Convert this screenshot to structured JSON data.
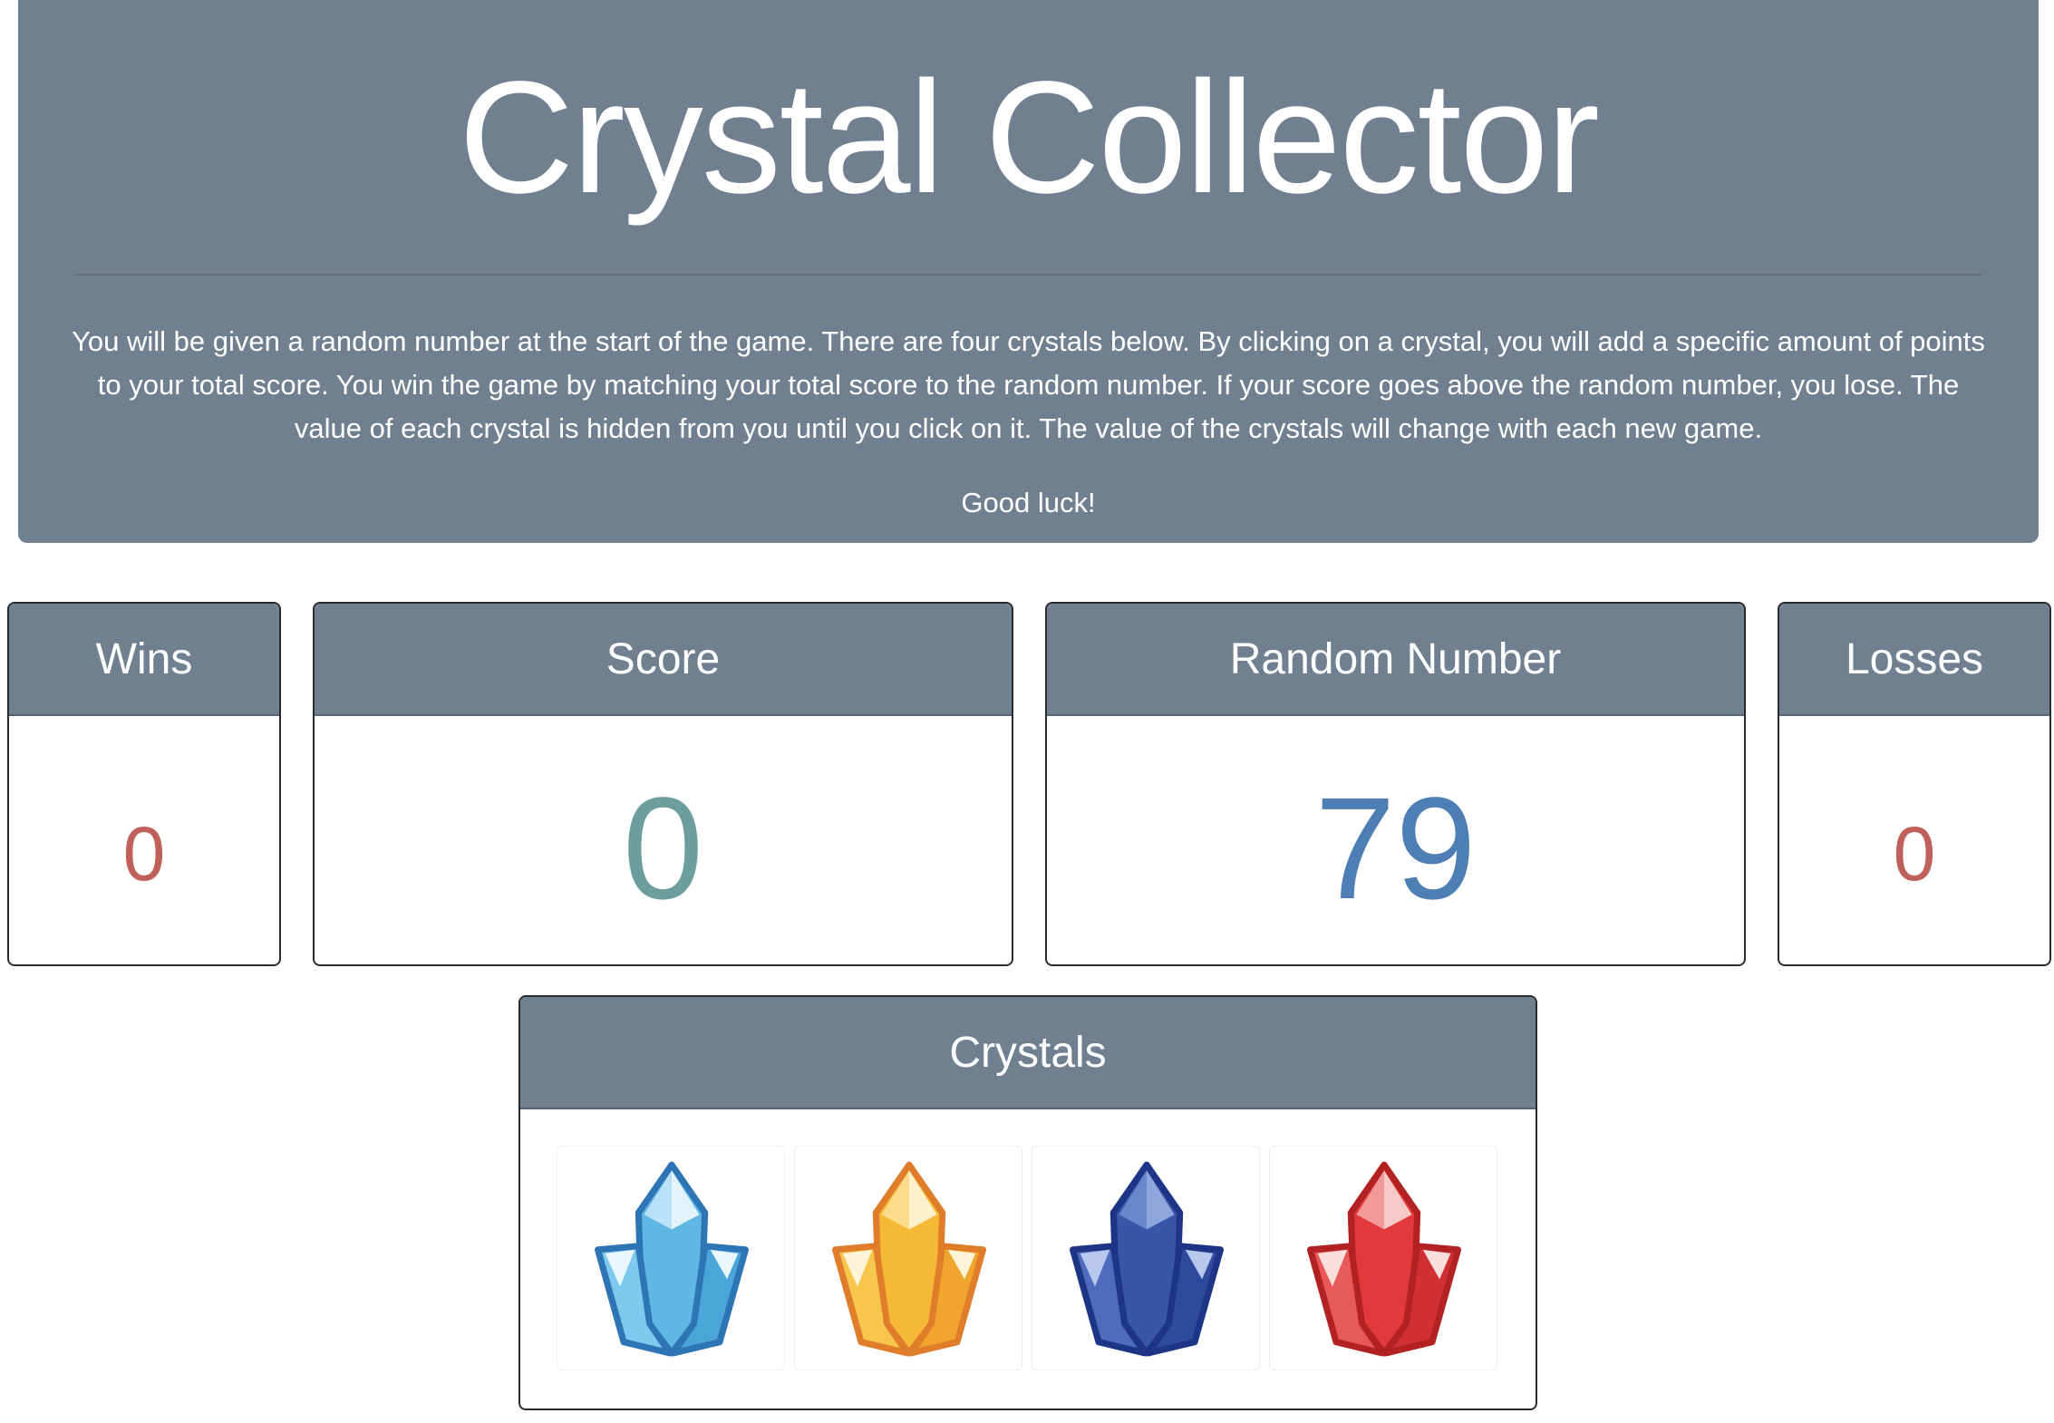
{
  "header": {
    "title": "Crystal Collector",
    "instructions": "You will be given a random number at the start of the game. There are four crystals below. By clicking on a crystal, you will add a specific amount of points to your total score. You win the game by matching your total score to the random number. If your score goes above the random number, you lose. The value of each crystal is hidden from you until you click on it. The value of the crystals will change with each new game.",
    "good_luck": "Good luck!"
  },
  "stats": {
    "wins": {
      "label": "Wins",
      "value": "0",
      "color": "#c0605a"
    },
    "score": {
      "label": "Score",
      "value": "0",
      "color": "#6b9e9c"
    },
    "random": {
      "label": "Random Number",
      "value": "79",
      "color": "#4e7fb4"
    },
    "losses": {
      "label": "Losses",
      "value": "0",
      "color": "#c0605a"
    }
  },
  "crystals": {
    "label": "Crystals",
    "items": [
      {
        "icon": "light-blue-crystal-icon"
      },
      {
        "icon": "yellow-crystal-icon"
      },
      {
        "icon": "dark-blue-crystal-icon"
      },
      {
        "icon": "red-crystal-icon"
      }
    ]
  },
  "colors": {
    "panel": "#708090"
  }
}
